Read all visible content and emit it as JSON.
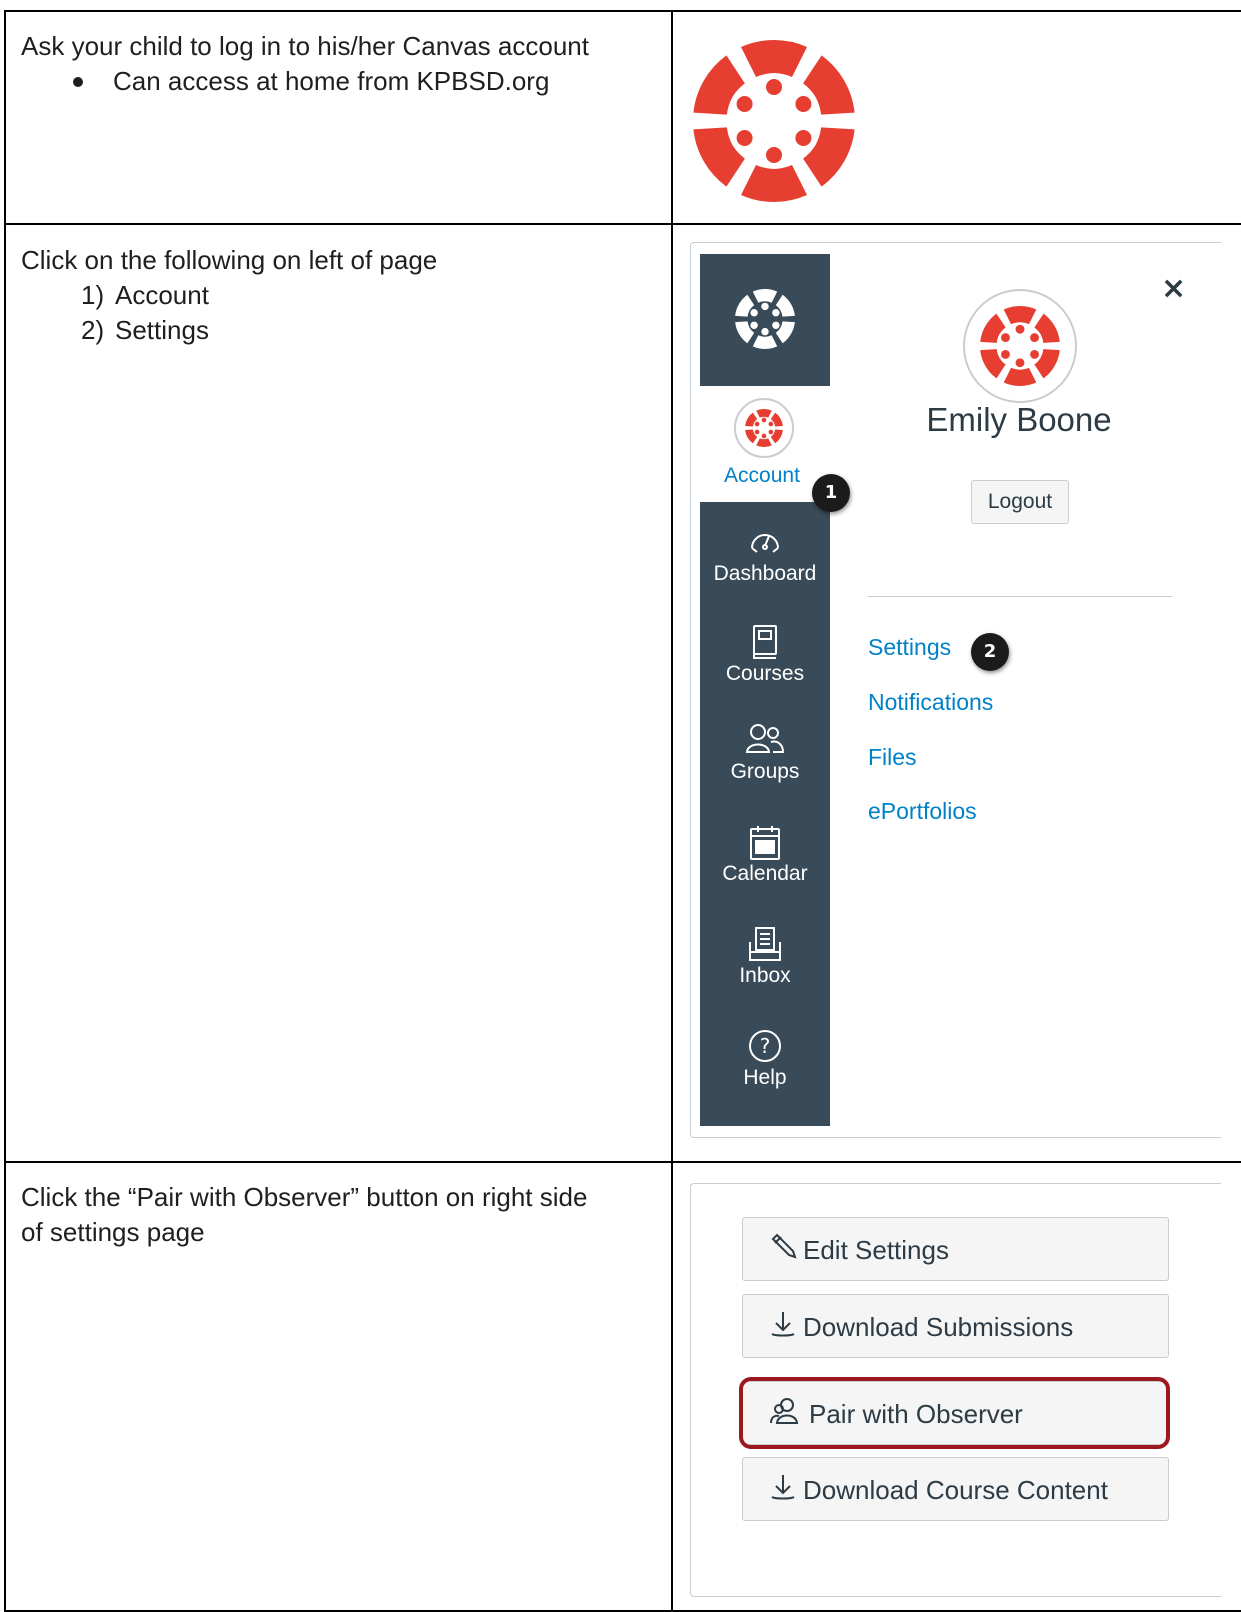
{
  "rows": [
    {
      "instruction": "Ask your child to log in to his/her Canvas account",
      "bullets": [
        "Can access at home from KPBSD.org"
      ]
    },
    {
      "instruction": "Click on the following on left of page",
      "steps": [
        {
          "num": "1)",
          "label": "Account"
        },
        {
          "num": "2)",
          "label": "Settings"
        }
      ]
    },
    {
      "instruction_line1": "Click the “Pair with Observer” button on right side",
      "instruction_line2": "of settings page"
    }
  ],
  "logo": {
    "icon": "canvas-logo-icon",
    "color": "#e63e30"
  },
  "account_panel": {
    "global_nav": [
      {
        "id": "account",
        "label": "Account",
        "icon": "avatar-icon"
      },
      {
        "id": "dashboard",
        "label": "Dashboard",
        "icon": "dashboard-icon"
      },
      {
        "id": "courses",
        "label": "Courses",
        "icon": "courses-icon"
      },
      {
        "id": "groups",
        "label": "Groups",
        "icon": "groups-icon"
      },
      {
        "id": "calendar",
        "label": "Calendar",
        "icon": "calendar-icon"
      },
      {
        "id": "inbox",
        "label": "Inbox",
        "icon": "inbox-icon"
      },
      {
        "id": "help",
        "label": "Help",
        "icon": "help-icon"
      }
    ],
    "close_symbol": "×",
    "user_name": "Emily Boone",
    "logout_label": "Logout",
    "links": [
      "Settings",
      "Notifications",
      "Files",
      "ePortfolios"
    ],
    "badges": [
      "1",
      "2"
    ],
    "colors": {
      "nav_bg": "#394b58",
      "link": "#0081c8",
      "badge": "#1b1b1b"
    }
  },
  "settings_sidebar": {
    "buttons": [
      {
        "label": "Edit Settings",
        "icon": "pencil-icon"
      },
      {
        "label": "Download Submissions",
        "icon": "download-icon"
      },
      {
        "label": "Pair with Observer",
        "icon": "pair-icon",
        "highlighted": true
      },
      {
        "label": "Download Course Content",
        "icon": "download-icon"
      }
    ],
    "highlight_color": "#9c1a1f"
  }
}
